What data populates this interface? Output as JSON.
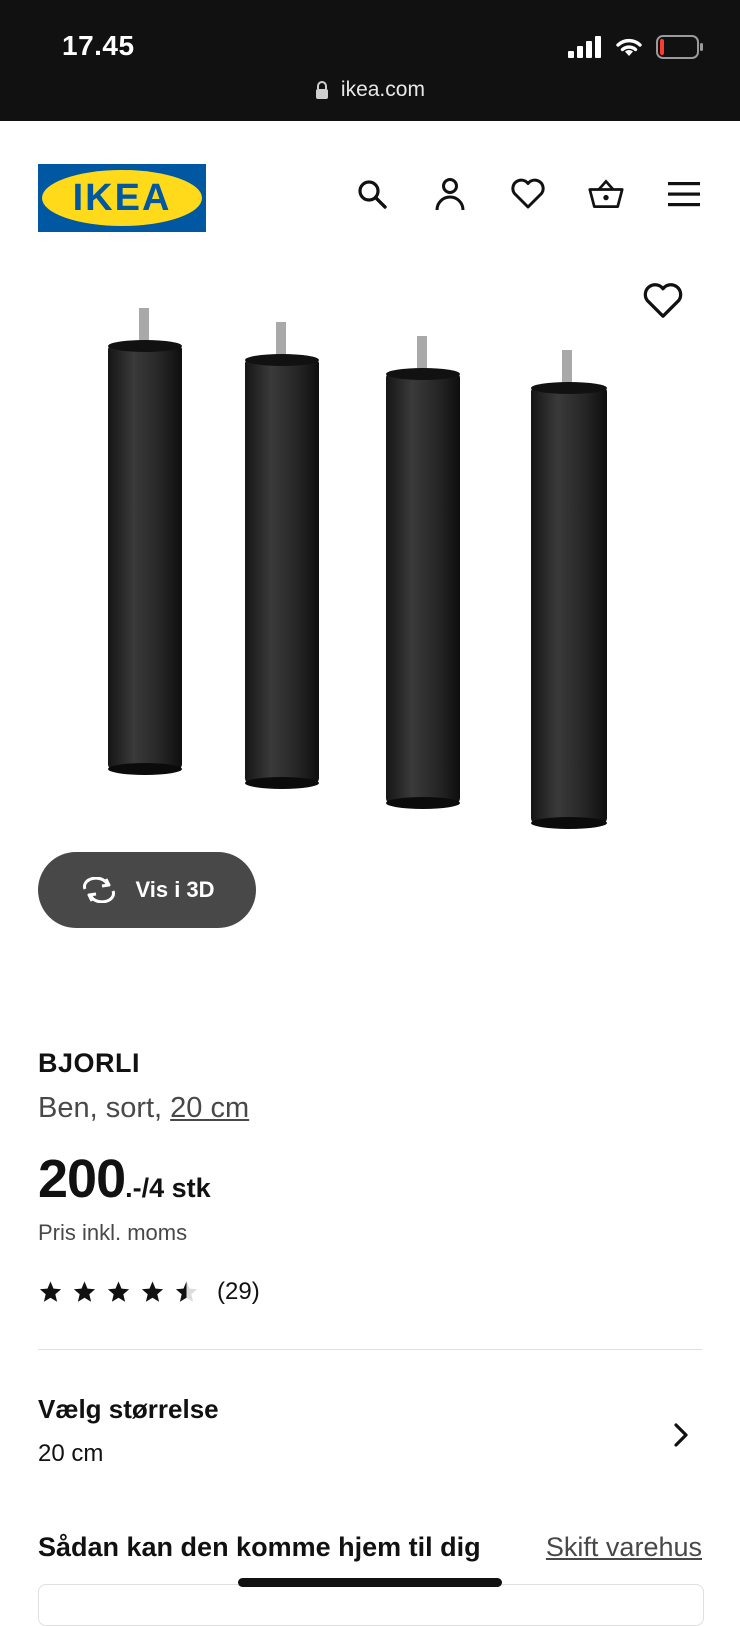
{
  "status_bar": {
    "time": "17.45",
    "battery_level": 0.1
  },
  "browser": {
    "url": "ikea.com"
  },
  "brand": {
    "logo_text": "IKEA",
    "logo_blue": "#0058a3",
    "logo_yellow": "#ffda1a"
  },
  "header": {
    "icons": [
      "search-icon",
      "account-icon",
      "favorites-icon",
      "basket-icon",
      "menu-icon"
    ]
  },
  "gallery": {
    "view_3d_label": "Vis i 3D"
  },
  "product": {
    "name": "BJORLI",
    "description_prefix": "Ben, sort, ",
    "size_link": "20 cm",
    "price_amount": "200",
    "price_suffix": ".-/4 stk",
    "vat_note": "Pris inkl. moms",
    "rating": 4.5,
    "rating_max": 5,
    "review_count": "(29)"
  },
  "size_selector": {
    "title": "Vælg størrelse",
    "value": "20 cm"
  },
  "delivery": {
    "title": "Sådan kan den komme hjem til dig",
    "change_store": "Skift varehus"
  }
}
